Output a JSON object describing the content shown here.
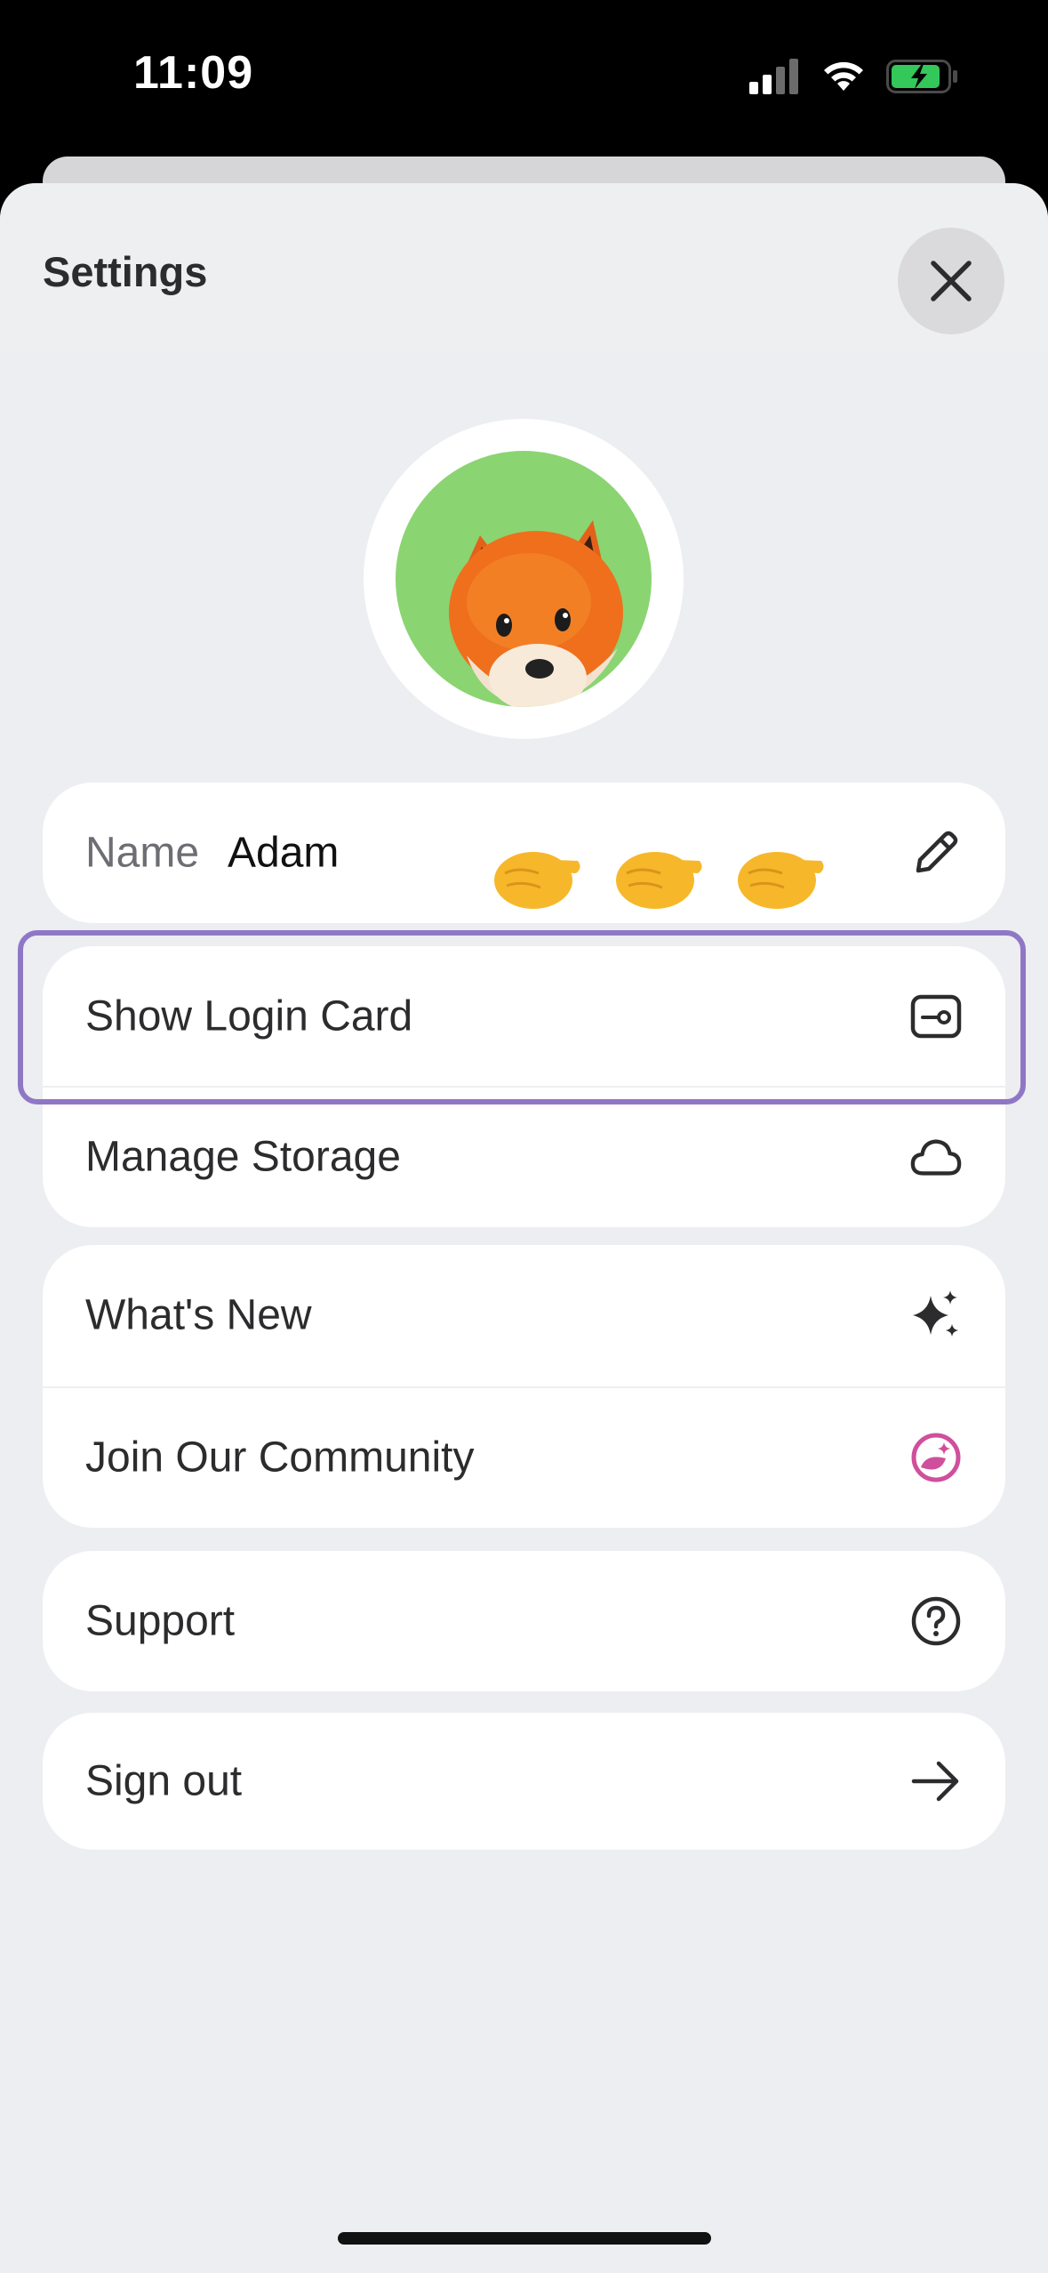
{
  "status_bar": {
    "time": "11:09",
    "icons": [
      "cellular-signal-icon",
      "wifi-icon",
      "battery-charging-icon"
    ]
  },
  "header": {
    "title": "Settings",
    "close_icon": "close-icon"
  },
  "profile": {
    "avatar": "fox-avatar",
    "avatar_bg_color": "#8bd472",
    "name_label": "Name",
    "name_value": "Adam",
    "edit_icon": "pencil-icon",
    "pointer_emojis": [
      "👉",
      "👉",
      "👉"
    ]
  },
  "menu": {
    "group_account": [
      {
        "label": "Show Login Card",
        "icon": "login-card-icon"
      },
      {
        "label": "Manage Storage",
        "icon": "cloud-icon"
      }
    ],
    "group_info": [
      {
        "label": "What's New",
        "icon": "sparkles-icon"
      },
      {
        "label": "Join Our Community",
        "icon": "community-icon"
      }
    ],
    "group_support": [
      {
        "label": "Support",
        "icon": "help-circle-icon"
      }
    ],
    "group_session": [
      {
        "label": "Sign out",
        "icon": "arrow-right-icon"
      }
    ]
  },
  "colors": {
    "highlight": "#9077c6",
    "community_accent": "#d04f9c",
    "background": "#eceef1",
    "card": "#ffffff"
  }
}
